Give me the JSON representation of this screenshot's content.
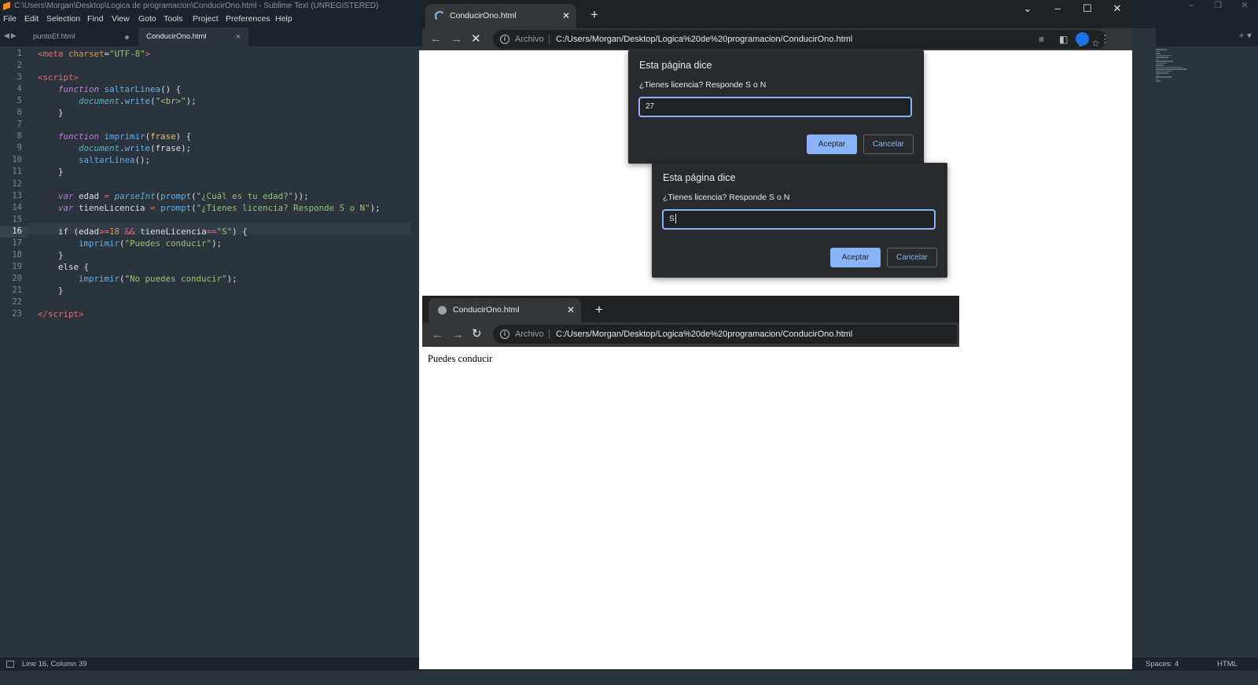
{
  "sublime": {
    "window_title": "C:\\Users\\Morgan\\Desktop\\Logica de programacion\\ConducirOno.html - Sublime Text (UNREGISTERED)",
    "menu": [
      "File",
      "Edit",
      "Selection",
      "Find",
      "View",
      "Goto",
      "Tools",
      "Project",
      "Preferences",
      "Help"
    ],
    "tabs": [
      {
        "label": "puntoEf.html",
        "state": "unsaved-dot"
      },
      {
        "label": "ConducirOno.html",
        "state": "active"
      }
    ],
    "line_numbers": [
      "1",
      "2",
      "3",
      "4",
      "5",
      "6",
      "7",
      "8",
      "9",
      "10",
      "11",
      "12",
      "13",
      "14",
      "15",
      "16",
      "17",
      "18",
      "19",
      "20",
      "21",
      "22",
      "23"
    ],
    "current_line": 16,
    "status": {
      "position": "Line 16, Column 39",
      "indent": "Spaces: 4",
      "syntax": "HTML"
    }
  },
  "browser_main": {
    "tab_title": "ConducirOno.html",
    "omnibox_label": "Archivo",
    "url": "C:/Users/Morgan/Desktop/Logica%20de%20programacion/ConducirOno.html",
    "loading": true
  },
  "dialogs": [
    {
      "title": "Esta página dice",
      "message": "¿Tienes licencia? Responde S o N",
      "input_value": "27",
      "ok_label": "Aceptar",
      "cancel_label": "Cancelar"
    },
    {
      "title": "Esta página dice",
      "message": "¿Tienes licencia? Responde S o N",
      "input_value": "S",
      "ok_label": "Aceptar",
      "cancel_label": "Cancelar"
    }
  ],
  "browser_secondary": {
    "tab_title": "ConducirOno.html",
    "omnibox_label": "Archivo",
    "url": "C:/Users/Morgan/Desktop/Logica%20de%20programacion/ConducirOno.html",
    "page_text": "Puedes conducir"
  },
  "colors": {
    "editor_bg": "#2b333d",
    "chrome_dark": "#202124",
    "chrome_toolbar": "#35363a",
    "dialog_accent": "#8ab4f8"
  }
}
